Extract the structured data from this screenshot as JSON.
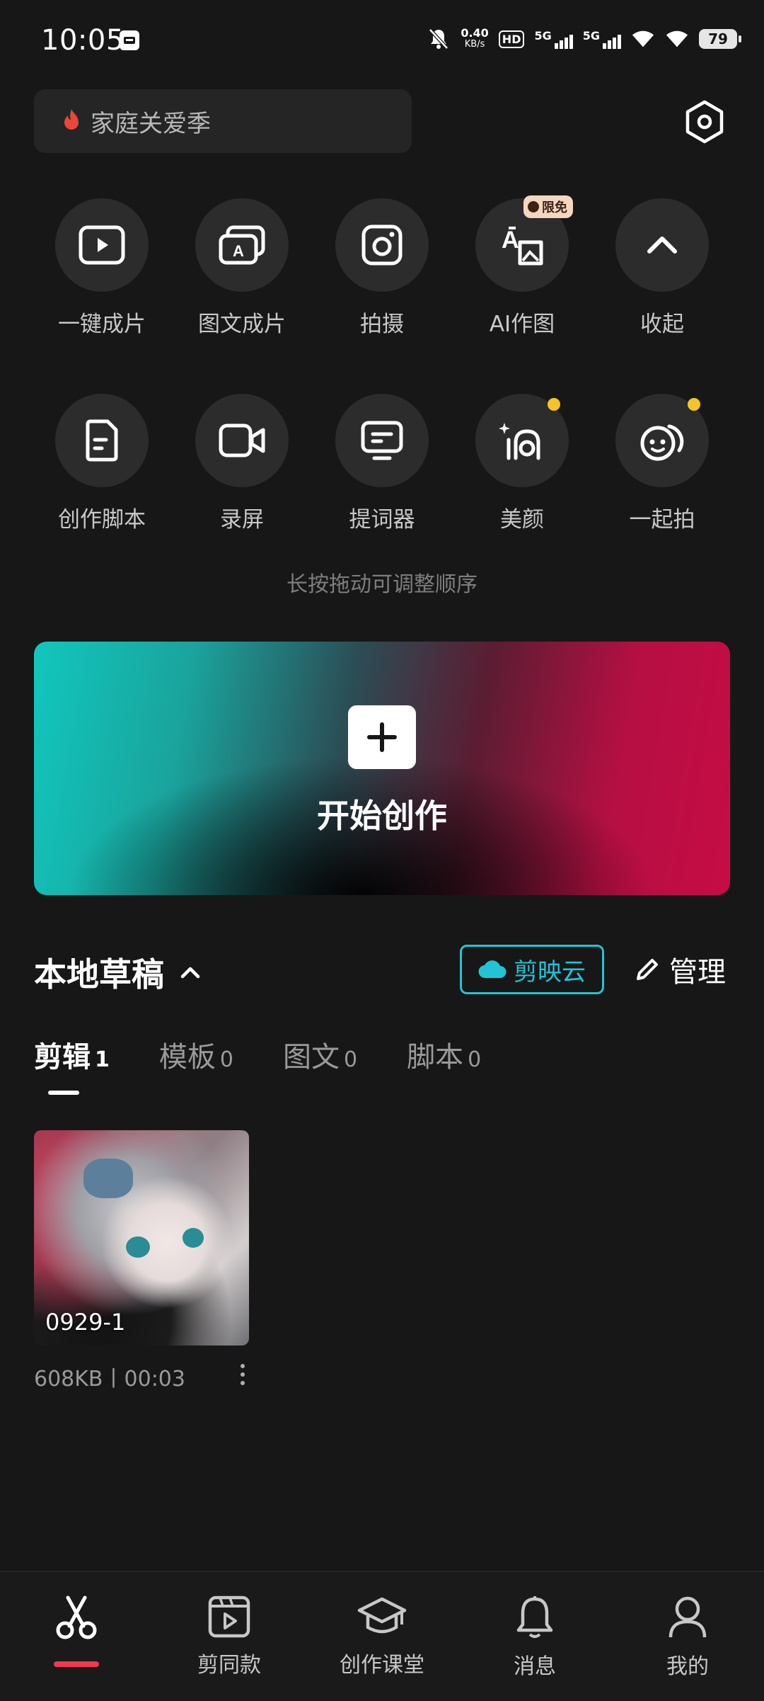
{
  "status_bar": {
    "time": "10:05",
    "net_speed_value": "0.40",
    "net_speed_unit": "KB/s",
    "hd_label": "HD",
    "sim1_label": "5G",
    "sim2_label": "5G",
    "battery": "79"
  },
  "search": {
    "placeholder": "家庭关爱季"
  },
  "tools": {
    "row1": [
      {
        "label": "一键成片",
        "icon": "play-icon"
      },
      {
        "label": "图文成片",
        "icon": "image-text-icon"
      },
      {
        "label": "拍摄",
        "icon": "camera-icon"
      },
      {
        "label": "AI作图",
        "icon": "ai-draw-icon",
        "badge": "限免"
      },
      {
        "label": "收起",
        "icon": "chevron-up-icon"
      }
    ],
    "row2": [
      {
        "label": "创作脚本",
        "icon": "script-icon"
      },
      {
        "label": "录屏",
        "icon": "screen-record-icon"
      },
      {
        "label": "提词器",
        "icon": "teleprompter-icon"
      },
      {
        "label": "美颜",
        "icon": "beauty-icon",
        "dot": true
      },
      {
        "label": "一起拍",
        "icon": "shoot-together-icon",
        "dot": true
      }
    ],
    "hint": "长按拖动可调整顺序"
  },
  "banner": {
    "title": "开始创作"
  },
  "drafts": {
    "title": "本地草稿",
    "cloud_label": "剪映云",
    "manage_label": "管理",
    "tabs": [
      {
        "label": "剪辑",
        "count": "1",
        "active": true
      },
      {
        "label": "模板",
        "count": "0"
      },
      {
        "label": "图文",
        "count": "0"
      },
      {
        "label": "脚本",
        "count": "0"
      }
    ],
    "items": [
      {
        "name": "0929-1",
        "meta": "608KB丨00:03"
      }
    ]
  },
  "bottom_nav": [
    {
      "label": "",
      "icon": "scissors-icon",
      "active": true
    },
    {
      "label": "剪同款",
      "icon": "template-icon"
    },
    {
      "label": "创作课堂",
      "icon": "graduation-cap-icon"
    },
    {
      "label": "消息",
      "icon": "bell-icon"
    },
    {
      "label": "我的",
      "icon": "user-icon"
    }
  ],
  "colors": {
    "background": "#171717",
    "accent_cyan": "#23c3d6",
    "accent_red": "#f0384f",
    "badge_dot": "#f6c525"
  }
}
